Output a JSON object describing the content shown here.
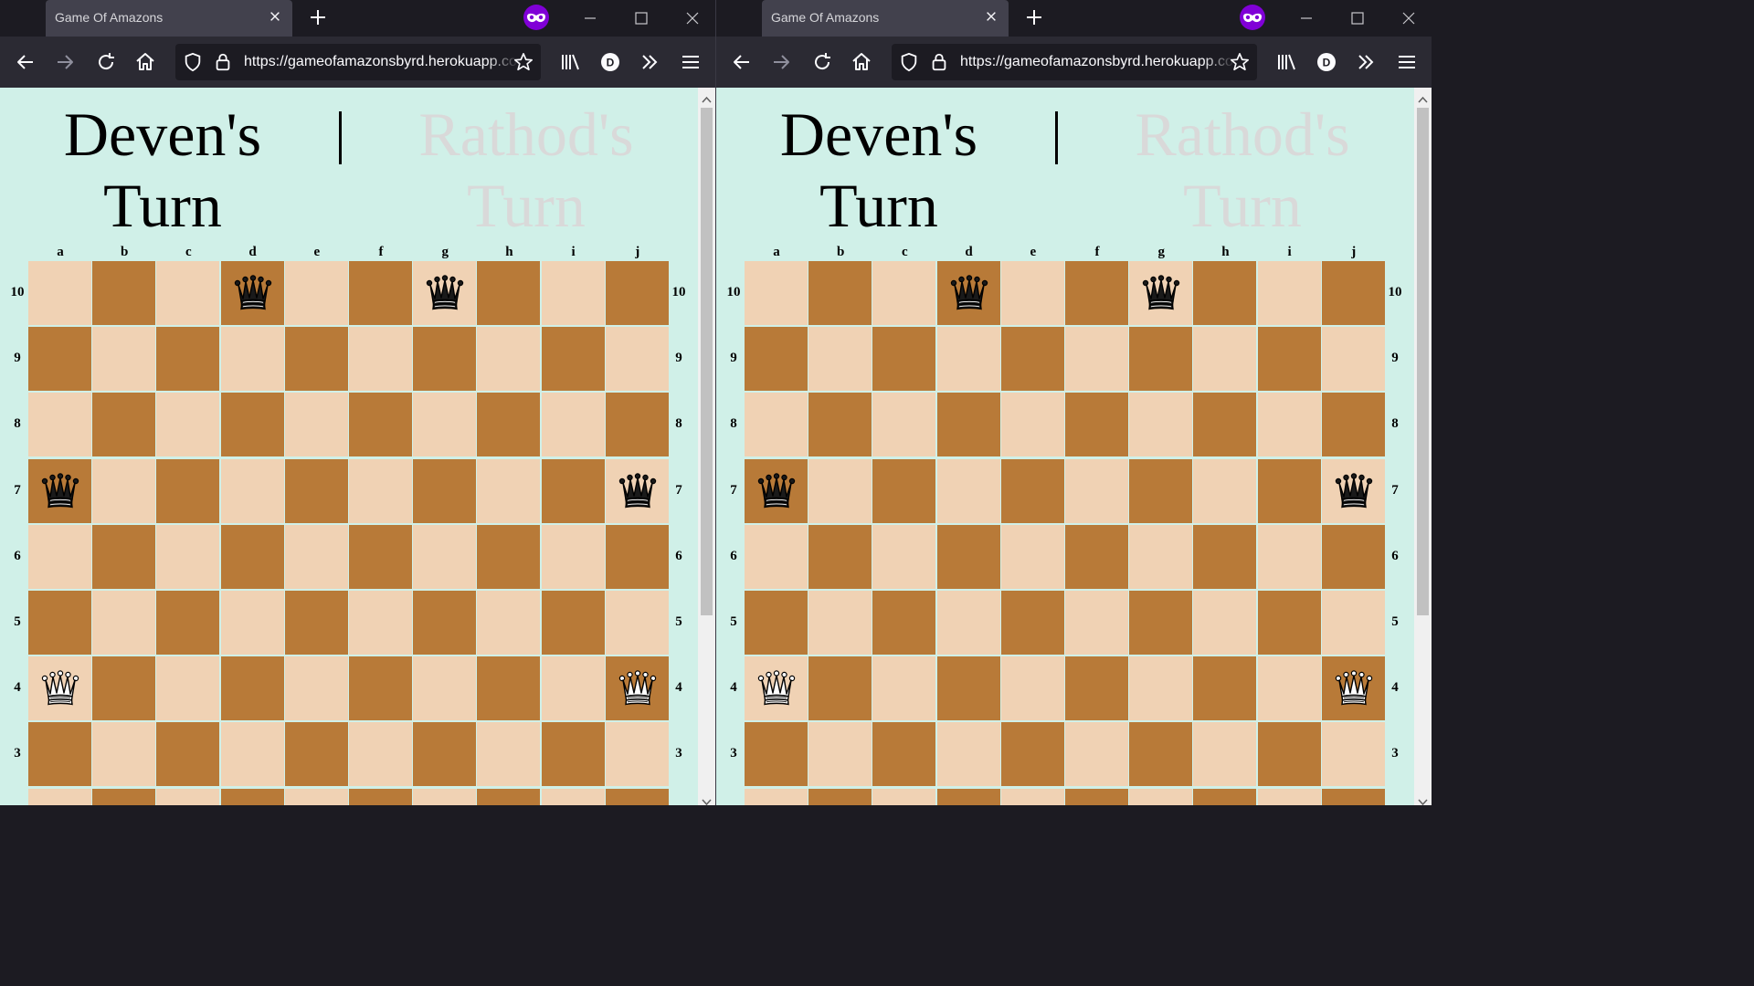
{
  "browser": {
    "tab_title": "Game Of Amazons",
    "url": "https://gameofamazonsbyrd.herokuapp.com/"
  },
  "game": {
    "player1_turn": "Deven's Turn",
    "separator": "|",
    "player2_turn": "Rathod's Turn",
    "files": [
      "a",
      "b",
      "c",
      "d",
      "e",
      "f",
      "g",
      "h",
      "i",
      "j"
    ],
    "ranks_visible": [
      "10",
      "9",
      "8",
      "7",
      "6",
      "5",
      "4",
      "3"
    ],
    "pieces": [
      {
        "square": "d10",
        "color": "black"
      },
      {
        "square": "g10",
        "color": "black"
      },
      {
        "square": "a7",
        "color": "black"
      },
      {
        "square": "j7",
        "color": "black"
      },
      {
        "square": "a4",
        "color": "white"
      },
      {
        "square": "j4",
        "color": "white"
      }
    ]
  },
  "colors": {
    "page_bg": "#d0f0e8",
    "light_square": "#f0d2b4",
    "dark_square": "#b87a38",
    "private_badge": "#8000d7"
  },
  "icons": {
    "tab_close": "close-icon",
    "new_tab": "plus-icon",
    "private": "private-browsing-icon",
    "back": "back-arrow-icon",
    "forward": "forward-arrow-icon",
    "reload": "reload-icon",
    "home": "home-icon",
    "tracking": "shield-icon",
    "secure": "lock-icon",
    "bookmark": "star-icon",
    "library": "library-icon",
    "account": "account-icon",
    "overflow": "chevrons-icon",
    "menu": "hamburger-icon",
    "queen": "queen-icon"
  }
}
